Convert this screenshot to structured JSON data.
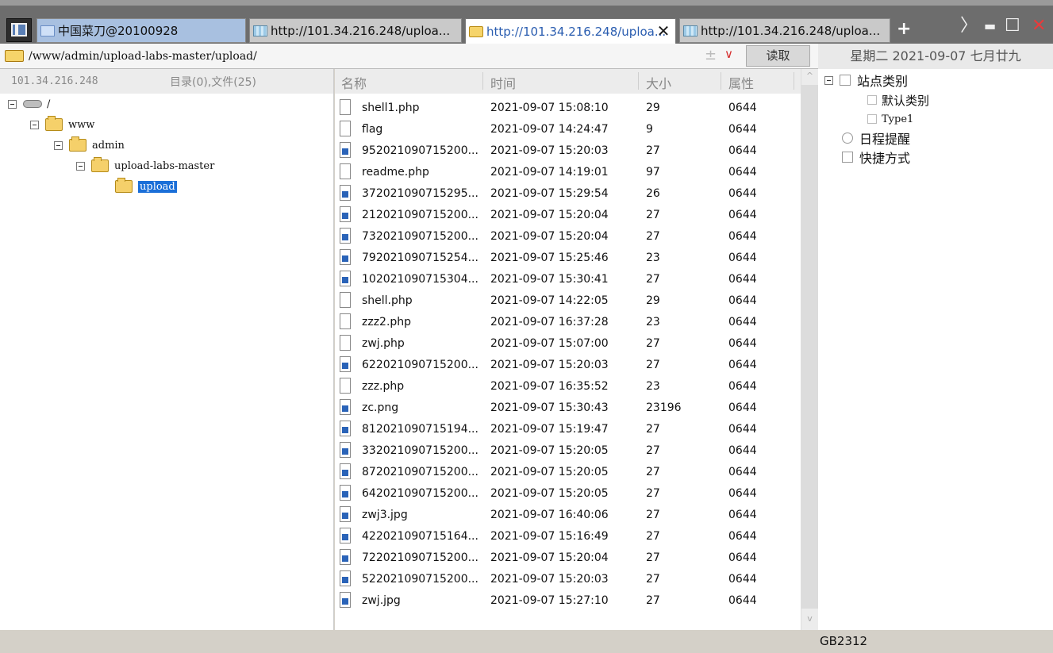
{
  "tabs": [
    {
      "label": "中国菜刀@20100928",
      "icon": "page-icon"
    },
    {
      "label": "http://101.34.216.248/uploa...",
      "icon": "web-icon"
    },
    {
      "label": "http://101.34.216.248/uploa...",
      "icon": "folder-icon",
      "active": true
    },
    {
      "label": "http://101.34.216.248/uploa...",
      "icon": "web-icon"
    }
  ],
  "tab_close_symbol": "✕",
  "new_tab_symbol": "+",
  "window_controls": {
    "nav": "〉",
    "minimize": "▬",
    "maximize": "☐",
    "close": "✕"
  },
  "address": {
    "path": "/www/admin/upload-labs-master/upload/",
    "plus": "±",
    "dropdown": "∨",
    "read_label": "读取"
  },
  "date_text": "星期二 2021-09-07 七月廿九",
  "left_panel": {
    "ip": "101.34.216.248",
    "count": "目录(0),文件(25)",
    "tree": [
      {
        "label": "/",
        "type": "drive"
      },
      {
        "label": "www",
        "type": "folder"
      },
      {
        "label": "admin",
        "type": "folder"
      },
      {
        "label": "upload-labs-master",
        "type": "folder"
      },
      {
        "label": "upload",
        "type": "folder",
        "selected": true
      }
    ]
  },
  "file_panel": {
    "headers": {
      "name": "名称",
      "time": "时间",
      "size": "大小",
      "attr": "属性"
    },
    "files": [
      {
        "name": "shell1.php",
        "time": "2021-09-07 15:08:10",
        "size": "29",
        "attr": "0644",
        "kind": "text"
      },
      {
        "name": "flag",
        "time": "2021-09-07 14:24:47",
        "size": "9",
        "attr": "0644",
        "kind": "text"
      },
      {
        "name": "952021090715200...",
        "time": "2021-09-07 15:20:03",
        "size": "27",
        "attr": "0644",
        "kind": "image"
      },
      {
        "name": "readme.php",
        "time": "2021-09-07 14:19:01",
        "size": "97",
        "attr": "0644",
        "kind": "text"
      },
      {
        "name": "372021090715295...",
        "time": "2021-09-07 15:29:54",
        "size": "26",
        "attr": "0644",
        "kind": "image"
      },
      {
        "name": "212021090715200...",
        "time": "2021-09-07 15:20:04",
        "size": "27",
        "attr": "0644",
        "kind": "image"
      },
      {
        "name": "732021090715200...",
        "time": "2021-09-07 15:20:04",
        "size": "27",
        "attr": "0644",
        "kind": "image"
      },
      {
        "name": "792021090715254...",
        "time": "2021-09-07 15:25:46",
        "size": "23",
        "attr": "0644",
        "kind": "image"
      },
      {
        "name": "102021090715304...",
        "time": "2021-09-07 15:30:41",
        "size": "27",
        "attr": "0644",
        "kind": "image"
      },
      {
        "name": "shell.php",
        "time": "2021-09-07 14:22:05",
        "size": "29",
        "attr": "0644",
        "kind": "text"
      },
      {
        "name": "zzz2.php",
        "time": "2021-09-07 16:37:28",
        "size": "23",
        "attr": "0644",
        "kind": "text"
      },
      {
        "name": "zwj.php",
        "time": "2021-09-07 15:07:00",
        "size": "27",
        "attr": "0644",
        "kind": "text"
      },
      {
        "name": "622021090715200...",
        "time": "2021-09-07 15:20:03",
        "size": "27",
        "attr": "0644",
        "kind": "image"
      },
      {
        "name": "zzz.php",
        "time": "2021-09-07 16:35:52",
        "size": "23",
        "attr": "0644",
        "kind": "text"
      },
      {
        "name": "zc.png",
        "time": "2021-09-07 15:30:43",
        "size": "23196",
        "attr": "0644",
        "kind": "image"
      },
      {
        "name": "812021090715194...",
        "time": "2021-09-07 15:19:47",
        "size": "27",
        "attr": "0644",
        "kind": "image"
      },
      {
        "name": "332021090715200...",
        "time": "2021-09-07 15:20:05",
        "size": "27",
        "attr": "0644",
        "kind": "image"
      },
      {
        "name": "872021090715200...",
        "time": "2021-09-07 15:20:05",
        "size": "27",
        "attr": "0644",
        "kind": "image"
      },
      {
        "name": "642021090715200...",
        "time": "2021-09-07 15:20:05",
        "size": "27",
        "attr": "0644",
        "kind": "image"
      },
      {
        "name": "zwj3.jpg",
        "time": "2021-09-07 16:40:06",
        "size": "27",
        "attr": "0644",
        "kind": "image"
      },
      {
        "name": "422021090715164...",
        "time": "2021-09-07 15:16:49",
        "size": "27",
        "attr": "0644",
        "kind": "image"
      },
      {
        "name": "722021090715200...",
        "time": "2021-09-07 15:20:04",
        "size": "27",
        "attr": "0644",
        "kind": "image"
      },
      {
        "name": "522021090715200...",
        "time": "2021-09-07 15:20:03",
        "size": "27",
        "attr": "0644",
        "kind": "image"
      },
      {
        "name": "zwj.jpg",
        "time": "2021-09-07 15:27:10",
        "size": "27",
        "attr": "0644",
        "kind": "image"
      }
    ]
  },
  "right_panel": [
    {
      "label": "站点类别",
      "kind": "root"
    },
    {
      "label": "默认类别",
      "kind": "sub"
    },
    {
      "label": "Type1",
      "kind": "sub"
    },
    {
      "label": "日程提醒",
      "kind": "clock"
    },
    {
      "label": "快捷方式",
      "kind": "shortcut"
    }
  ],
  "status": {
    "encoding": "GB2312"
  }
}
